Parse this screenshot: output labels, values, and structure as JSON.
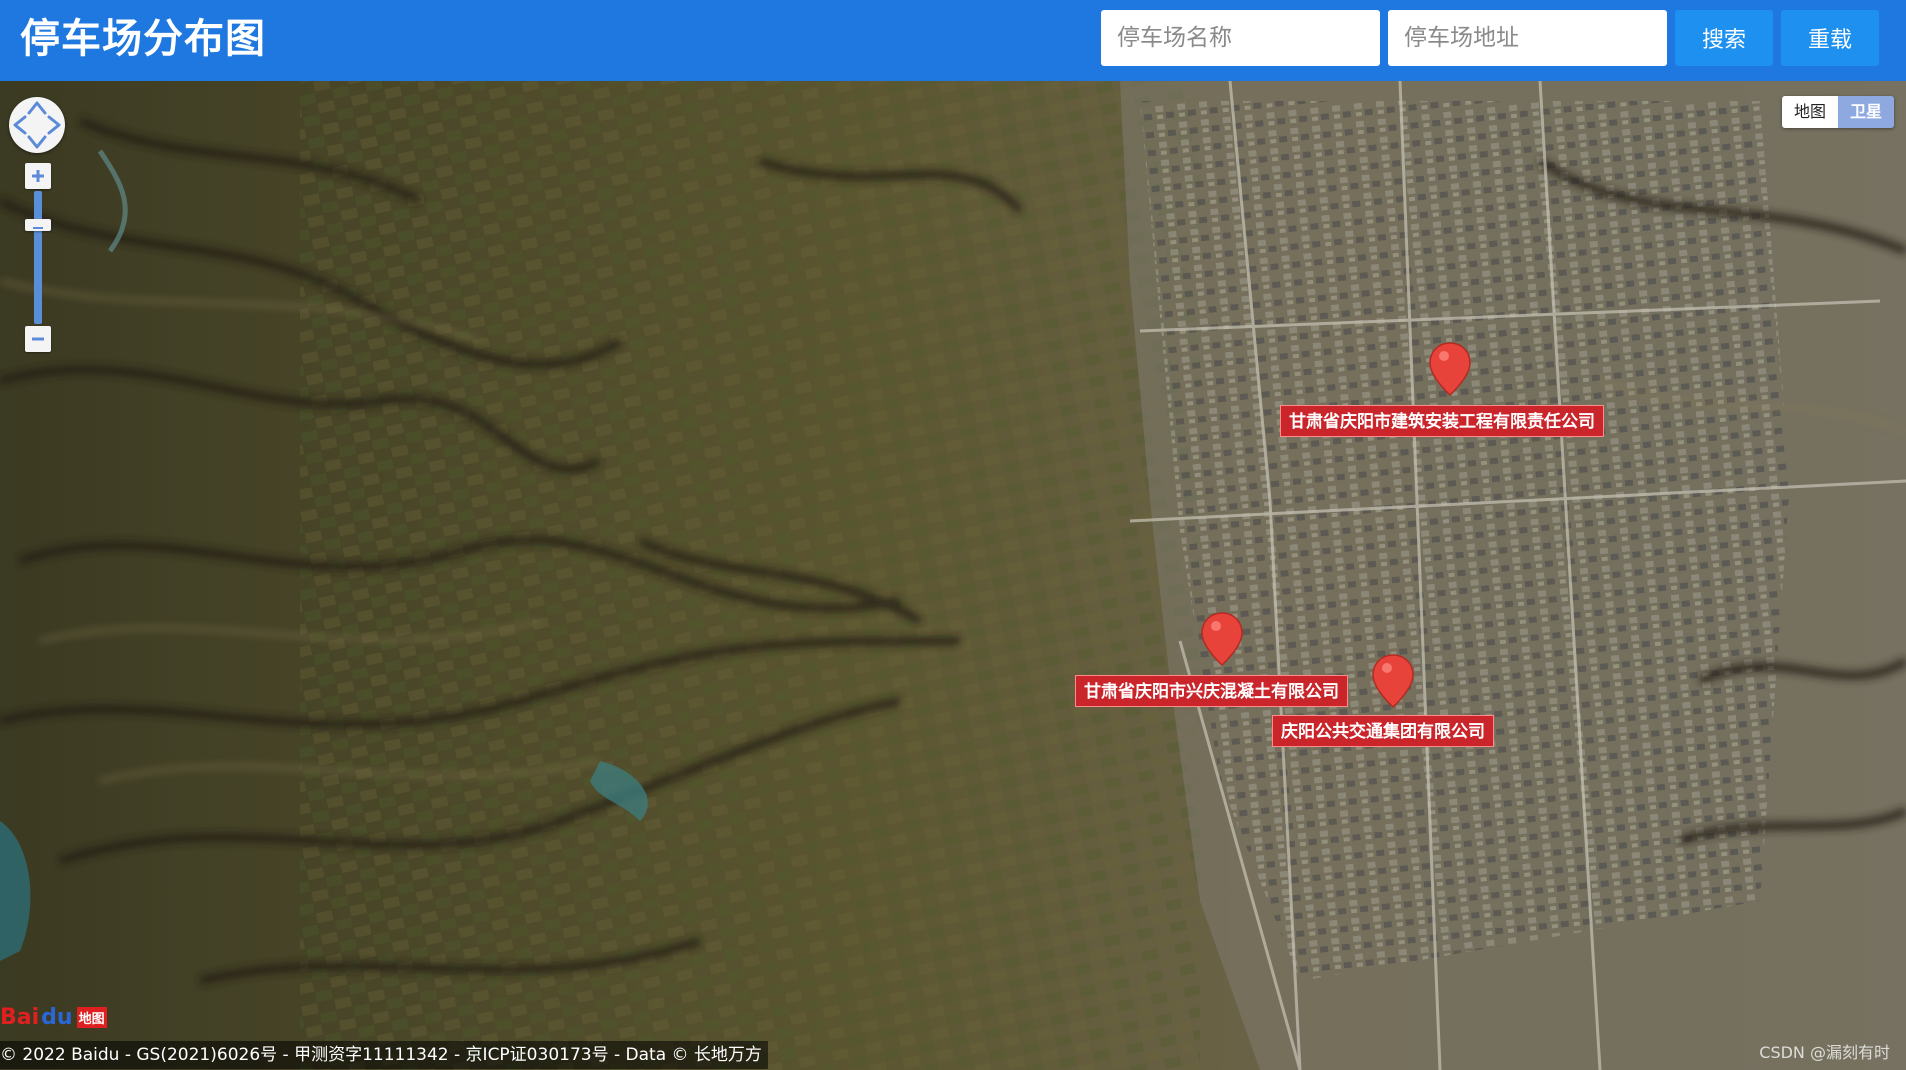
{
  "header": {
    "title": "停车场分布图",
    "name_placeholder": "停车场名称",
    "address_placeholder": "停车场地址",
    "search_label": "搜索",
    "reset_label": "重载",
    "bg_color": "#1e78e0",
    "button_color": "#1e90f0"
  },
  "map": {
    "type_options": [
      "地图",
      "卫星"
    ],
    "active_type": "卫星",
    "nav": {
      "zoom_in": "+",
      "zoom_out": "−"
    },
    "markers": [
      {
        "label": "甘肃省庆阳市建筑安装工程有限责任公司"
      },
      {
        "label": "甘肃省庆阳市兴庆混凝土有限公司"
      },
      {
        "label": "庆阳公共交通集团有限公司"
      }
    ],
    "marker_color": "#e8433a",
    "label_color": "#c9252b"
  },
  "footer": {
    "logo_text": "Bai",
    "logo_paw": "du",
    "logo_map": "地图",
    "copyright": "© 2022 Baidu - GS(2021)6026号 - 甲测资字11111342 - 京ICP证030173号 - Data © 长地万方",
    "watermark": "CSDN @漏刻有时"
  }
}
